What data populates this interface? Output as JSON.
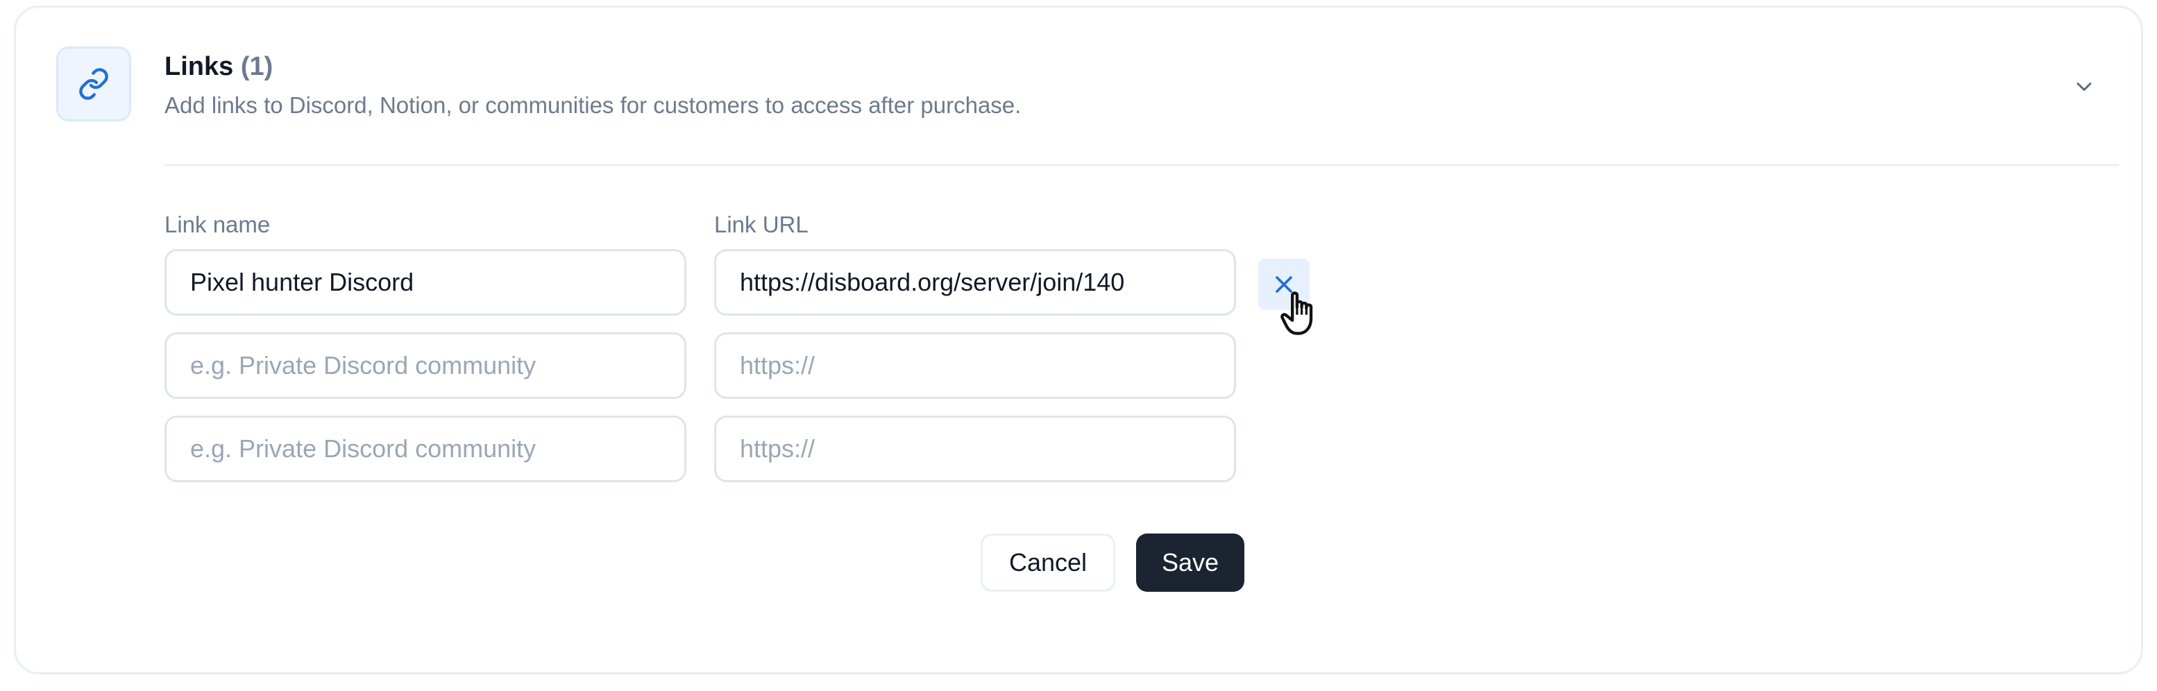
{
  "section": {
    "title": "Links",
    "count": "(1)",
    "subtitle": "Add links to Discord, Notion, or communities for customers to access after purchase.",
    "icon": "link-icon",
    "toggle_icon": "chevron-down-icon"
  },
  "form": {
    "name_label": "Link name",
    "url_label": "Link URL",
    "rows": [
      {
        "name_value": "Pixel hunter Discord",
        "name_placeholder": "e.g. Private Discord community",
        "url_value": "https://disboard.org/server/join/140",
        "url_placeholder": "https://"
      },
      {
        "name_value": "",
        "name_placeholder": "e.g. Private Discord community",
        "url_value": "",
        "url_placeholder": "https://"
      },
      {
        "name_value": "",
        "name_placeholder": "e.g. Private Discord community",
        "url_value": "",
        "url_placeholder": "https://"
      }
    ],
    "remove_icon": "close-icon"
  },
  "actions": {
    "cancel_label": "Cancel",
    "save_label": "Save"
  },
  "colors": {
    "accent": "#1f6fdb",
    "save_bg": "#1c2431"
  }
}
